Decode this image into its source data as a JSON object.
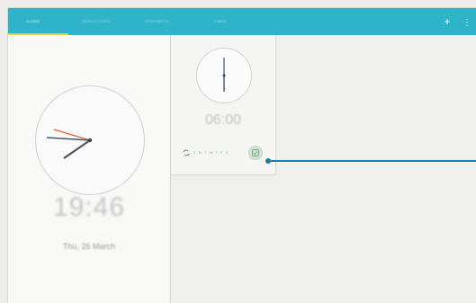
{
  "tabs": [
    {
      "label": "Alarm",
      "active": true
    },
    {
      "label": "World clock",
      "active": false
    },
    {
      "label": "Stopwatch",
      "active": false
    },
    {
      "label": "Timer",
      "active": false
    }
  ],
  "actions": {
    "add_label": "+",
    "more_label": "⋮"
  },
  "clock_view": {
    "time": "19:46",
    "date": "Thu, 26 March"
  },
  "alarm": {
    "time": "06:00",
    "days": "S M T W T F S",
    "enabled": true
  },
  "colors": {
    "accent": "#2eb4c8",
    "tab_indicator": "#f3c64a",
    "callout": "#1a7aa8",
    "day_active": "#6bbf7a"
  },
  "icons": {
    "add": "plus-icon",
    "more": "more-vert-icon",
    "repeat": "repeat-icon",
    "alarm_toggle": "alarm-check-icon"
  }
}
